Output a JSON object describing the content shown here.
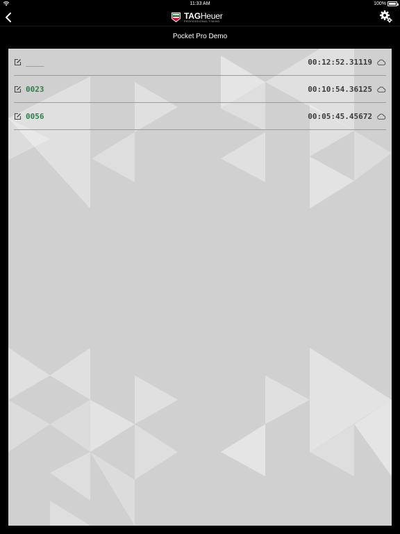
{
  "status_bar": {
    "time": "11:33 AM",
    "battery_percent": "100%",
    "battery_level": 1.0
  },
  "nav": {
    "logo": {
      "word_tag": "TAG",
      "word_heuer": "Heuer",
      "subtitle": "PROFESSIONAL TIMING"
    },
    "back_icon": "chevron-left-icon",
    "settings_icon": "gear-icon"
  },
  "subtitle": "Pocket Pro Demo",
  "colors": {
    "background": "#000000",
    "panel": "#d0d0d0",
    "bib_green": "#2e7d4a",
    "time_text": "#3a3a3a"
  },
  "records": [
    {
      "bib": "____",
      "time": "00:12:52.31119"
    },
    {
      "bib": "0023",
      "time": "00:10:54.36125"
    },
    {
      "bib": "0056",
      "time": "00:05:45.45672"
    }
  ]
}
